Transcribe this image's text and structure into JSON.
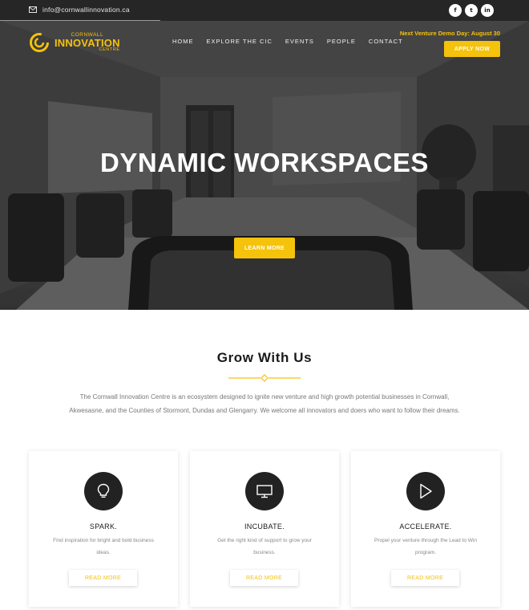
{
  "topbar": {
    "email": "info@cornwallinnovation.ca",
    "socials": [
      {
        "icon": "facebook-icon",
        "glyph": "f"
      },
      {
        "icon": "twitter-icon",
        "glyph": "t"
      },
      {
        "icon": "linkedin-icon",
        "glyph": "in"
      }
    ]
  },
  "logo": {
    "line1": "CORNWALL",
    "line2": "INNOVATION",
    "line3": "CENTRE"
  },
  "nav": [
    "HOME",
    "EXPLORE THE CIC",
    "EVENTS",
    "PEOPLE",
    "CONTACT"
  ],
  "demo_day": "Next Venture Demo Day: August 30",
  "apply_label": "APPLY NOW",
  "hero": {
    "title": "DYNAMIC WORKSPACES",
    "button": "LEARN MORE"
  },
  "grow": {
    "title": "Grow With Us",
    "intro_line1": "The Cornwall Innovation Centre is an ecosystem designed to ignite new venture and high growth potential businesses in Cornwall,",
    "intro_line2": "Akwesasne, and the Counties of Stormont, Dundas and Glengarry. We welcome all innovators and doers who want to follow their dreams."
  },
  "cards": [
    {
      "icon": "lightbulb-icon",
      "title": "SPARK.",
      "desc1": "Find inspiration for bright and bold business",
      "desc2": "ideas.",
      "button": "READ MORE"
    },
    {
      "icon": "monitor-icon",
      "title": "INCUBATE.",
      "desc1": "Get the right kind of support to grow your",
      "desc2": "business.",
      "button": "READ MORE"
    },
    {
      "icon": "play-icon",
      "title": "ACCELERATE.",
      "desc1": "Propel your venture through the Lead to Win",
      "desc2": "program.",
      "button": "READ MORE"
    }
  ],
  "colors": {
    "accent": "#f5c20c",
    "topbar": "#262626",
    "icon_circle": "#222222"
  }
}
